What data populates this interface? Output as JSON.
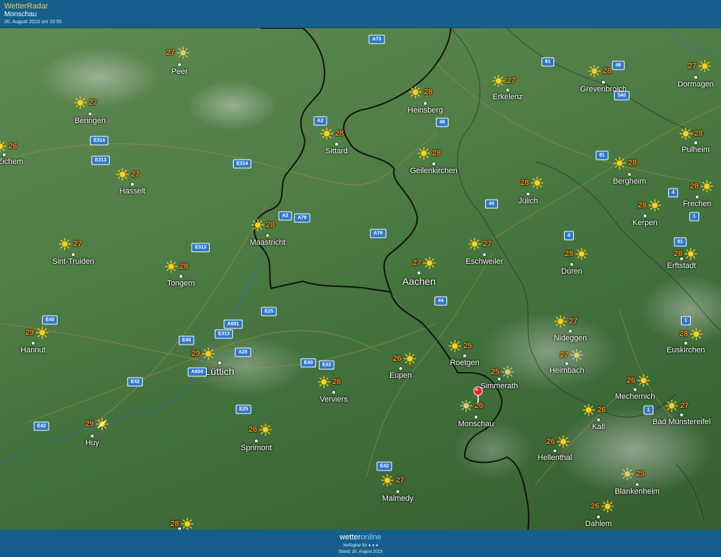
{
  "header": {
    "app_name": "WetterRadar",
    "location": "Monschau",
    "timestamp": "20. August 2023 um 16:55"
  },
  "footer": {
    "brand_part1": "wetter",
    "brand_part2": "online",
    "availability": "Verfügbar für ● ● ●",
    "stand": "Stand: 20. August 2023"
  },
  "colors": {
    "bar": "#165f8c",
    "temp": "#ff8c1a",
    "app_name": "#f2c94c",
    "road_badge": "#2f78c8",
    "pin": "#e0262b"
  },
  "map": {
    "pin_location": "Monschau",
    "cities": [
      {
        "name": "Peer",
        "temp": "27",
        "icon": "sun-icon",
        "faded": true
      },
      {
        "name": "Beringen",
        "temp": "27",
        "icon": "sun-icon"
      },
      {
        "name": "vel-Zichem",
        "temp": "26",
        "icon": "sun-icon"
      },
      {
        "name": "Hasselt",
        "temp": "27",
        "icon": "sun-icon"
      },
      {
        "name": "Sint-Truiden",
        "temp": "27",
        "icon": "sun-icon"
      },
      {
        "name": "Tongern",
        "temp": "28",
        "icon": "sun-icon"
      },
      {
        "name": "Maastricht",
        "temp": "28",
        "icon": "sun-icon"
      },
      {
        "name": "Sittard",
        "temp": "28",
        "icon": "sun-icon"
      },
      {
        "name": "Heinsberg",
        "temp": "28",
        "icon": "sun-icon"
      },
      {
        "name": "Erkelenz",
        "temp": "27",
        "icon": "sun-icon"
      },
      {
        "name": "Grevenbroich",
        "temp": "28",
        "icon": "sun-icon"
      },
      {
        "name": "Dormagen",
        "temp": "27",
        "icon": "sun-icon"
      },
      {
        "name": "Geilenkirchen",
        "temp": "28",
        "icon": "sun-icon"
      },
      {
        "name": "Pulheim",
        "temp": "28",
        "icon": "sun-icon"
      },
      {
        "name": "Jülich",
        "temp": "28",
        "icon": "sun-icon"
      },
      {
        "name": "Bergheim",
        "temp": "28",
        "icon": "sun-icon"
      },
      {
        "name": "Frechen",
        "temp": "28",
        "icon": "sun-icon"
      },
      {
        "name": "Kerpen",
        "temp": "28",
        "icon": "sun-icon"
      },
      {
        "name": "Eschweiler",
        "temp": "27",
        "icon": "sun-icon"
      },
      {
        "name": "Aachen",
        "temp": "27",
        "icon": "sun-icon",
        "big": true
      },
      {
        "name": "Düren",
        "temp": "28",
        "icon": "sun-icon"
      },
      {
        "name": "Erftstadt",
        "temp": "28",
        "icon": "sun-icon"
      },
      {
        "name": "Hannut",
        "temp": "29",
        "icon": "sun-icon"
      },
      {
        "name": "Lüttich",
        "temp": "29",
        "icon": "sun-icon",
        "big": true
      },
      {
        "name": "Verviers",
        "temp": "26",
        "icon": "sun-icon"
      },
      {
        "name": "Eupen",
        "temp": "26",
        "icon": "sun-icon"
      },
      {
        "name": "Roetgen",
        "temp": "25",
        "icon": "sun-icon"
      },
      {
        "name": "Simmerath",
        "temp": "25",
        "icon": "sun-icon",
        "faded": true
      },
      {
        "name": "Monschau",
        "temp": "26",
        "icon": "sun-icon",
        "faded": true
      },
      {
        "name": "Nideggen",
        "temp": "27",
        "icon": "sun-icon"
      },
      {
        "name": "Heimbach",
        "temp": "27",
        "icon": "sun-icon",
        "faded": true
      },
      {
        "name": "Euskirchen",
        "temp": "28",
        "icon": "sun-icon"
      },
      {
        "name": "Mechernich",
        "temp": "26",
        "icon": "sun-icon"
      },
      {
        "name": "Kall",
        "temp": "26",
        "icon": "sun-icon"
      },
      {
        "name": "Bad Münstereifel",
        "temp": "27",
        "icon": "sun-icon"
      },
      {
        "name": "Huy",
        "temp": "29",
        "icon": "sun-cloud-icon"
      },
      {
        "name": "Sprimont",
        "temp": "26",
        "icon": "sun-icon"
      },
      {
        "name": "Hellenthal",
        "temp": "26",
        "icon": "sun-icon"
      },
      {
        "name": "Blankenheim",
        "temp": "25",
        "icon": "sun-icon",
        "faded": true
      },
      {
        "name": "Malmedy",
        "temp": "27",
        "icon": "sun-icon"
      },
      {
        "name": "Dahlem",
        "temp": "26",
        "icon": "sun-icon"
      },
      {
        "name": "",
        "temp": "28",
        "icon": "sun-icon"
      }
    ],
    "roads": [
      "A73",
      "61",
      "46",
      "540",
      "A2",
      "46",
      "E314",
      "E313",
      "E314",
      "61",
      "A2",
      "A79",
      "44",
      "4",
      "1",
      "A76",
      "E313",
      "4",
      "61",
      "1",
      "E40",
      "E25",
      "A601",
      "E313",
      "E40",
      "A25",
      "E40",
      "E42",
      "A604",
      "E42",
      "44",
      "E25",
      "E42",
      "E42",
      "1"
    ]
  }
}
